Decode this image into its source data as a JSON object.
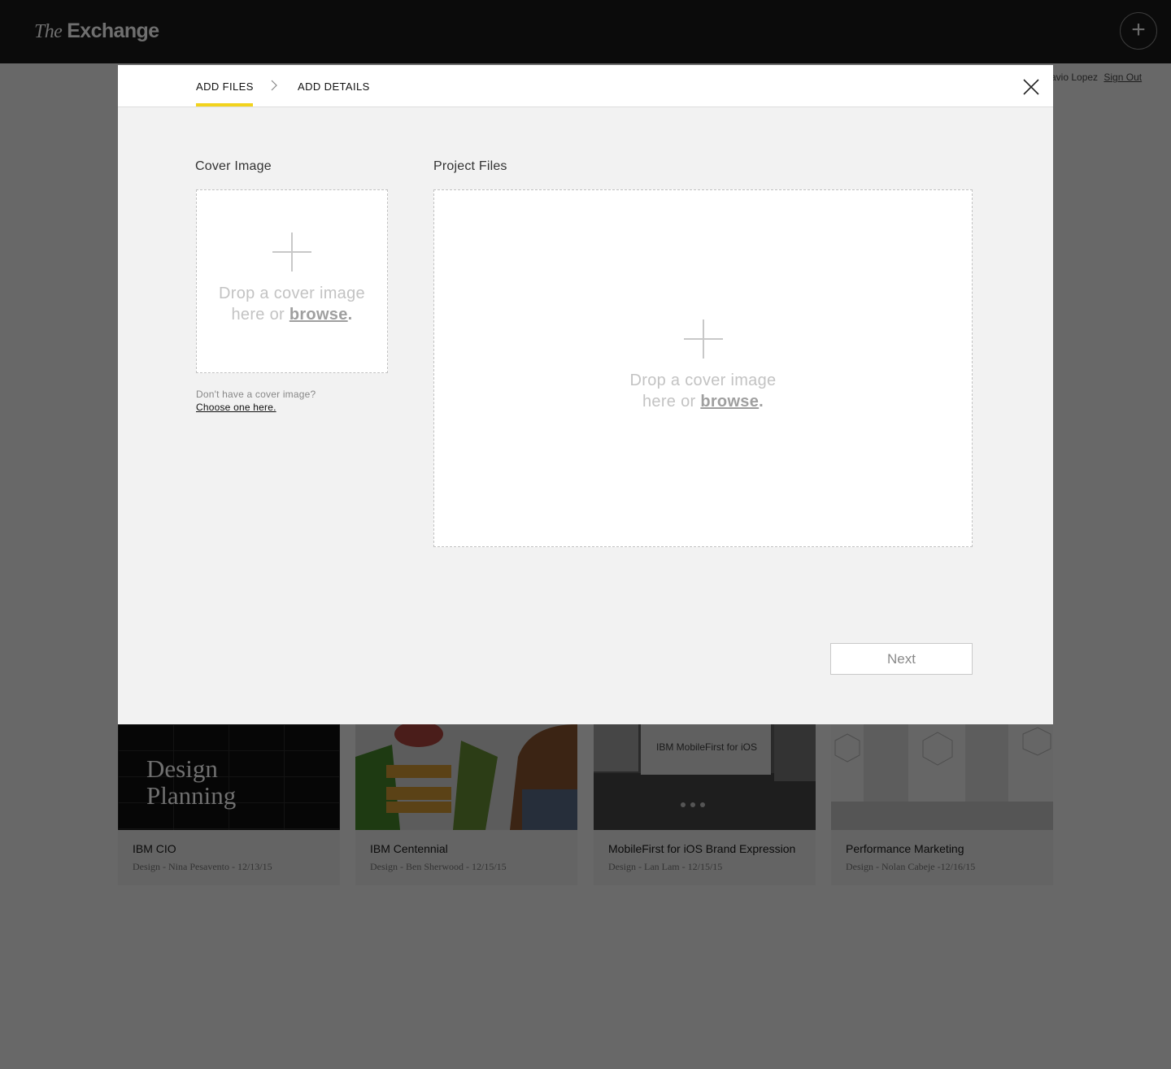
{
  "app": {
    "logo_prefix": "The",
    "logo_name": "Exchange",
    "add_icon": "plus-icon"
  },
  "user": {
    "name_visible": "avio Lopez",
    "sign_out": "Sign Out"
  },
  "modal": {
    "steps": [
      {
        "label": "ADD FILES",
        "active": true
      },
      {
        "label": "ADD DETAILS",
        "active": false
      }
    ],
    "close_icon": "close-icon",
    "accent_color": "#f2d31d",
    "cover": {
      "label": "Cover Image",
      "drop_text": "Drop a cover image",
      "drop_text_2": "here or",
      "browse": "browse",
      "no_cover_question": "Don't have a cover image?",
      "no_cover_link": "Choose one here."
    },
    "project": {
      "label": "Project Files",
      "drop_text": "Drop a cover image",
      "drop_text_2": "here or",
      "browse": "browse"
    },
    "next_label": "Next"
  },
  "cards": [
    {
      "title": "IBM CIO",
      "meta": "Design - Nina Pesavento - 12/13/15",
      "thumb_text_1": "Design",
      "thumb_text_2": "Planning"
    },
    {
      "title": "IBM Centennial",
      "meta": "Design - Ben Sherwood - 12/15/15"
    },
    {
      "title": "MobileFirst for iOS Brand Expression",
      "meta": "Design - Lan Lam - 12/15/15",
      "thumb_text": "IBM MobileFirst for iOS"
    },
    {
      "title": "Performance Marketing",
      "meta": "Design - Nolan Cabeje -12/16/15"
    }
  ]
}
